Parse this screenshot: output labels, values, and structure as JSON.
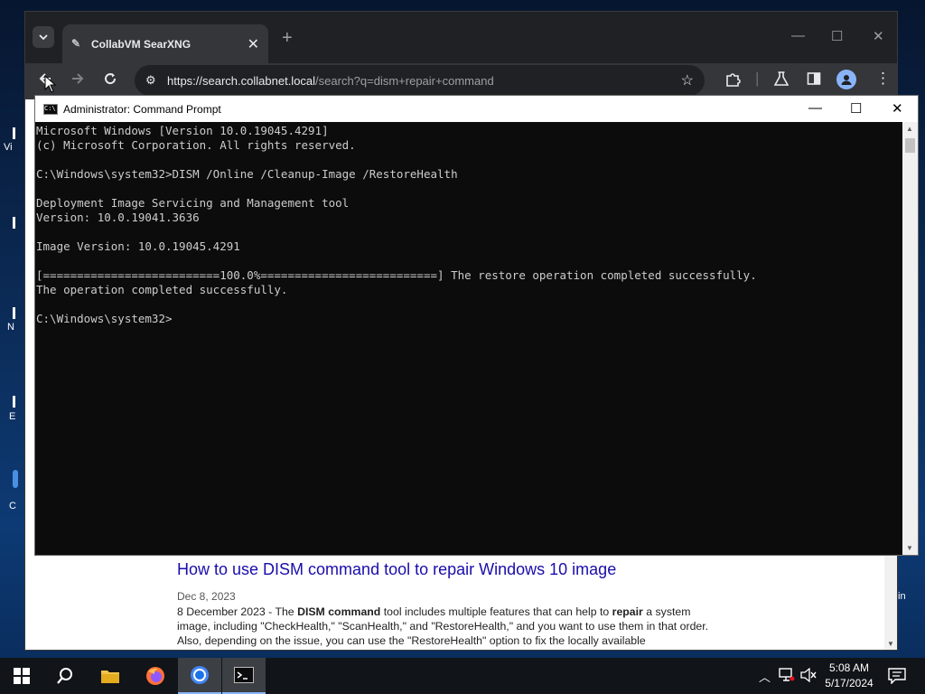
{
  "desktop": {
    "labels": [
      "Vi",
      "N",
      "E",
      "C",
      "in"
    ]
  },
  "browser": {
    "tab_title": "CollabVM SearXNG",
    "new_tab_symbol": "+",
    "url_host": "https://search.collabnet.local",
    "url_rest": "/search?q=dism+repair+command",
    "result": {
      "title": "How to use DISM command tool to repair Windows 10 image",
      "date": "Dec 8, 2023",
      "snippet": {
        "s1": "8 December 2023 - The ",
        "b1": "DISM command",
        "s2": " tool includes multiple features that can help to ",
        "b2": "repair",
        "s3": " a system image, including \"CheckHealth,\" \"ScanHealth,\" and \"RestoreHealth,\" and you want to use them in that order. Also, depending on the issue, you can use the \"RestoreHealth\" option to fix the locally available"
      }
    }
  },
  "cmd": {
    "title": "Administrator: Command Prompt",
    "lines": [
      "Microsoft Windows [Version 10.0.19045.4291]",
      "(c) Microsoft Corporation. All rights reserved.",
      "",
      "C:\\Windows\\system32>DISM /Online /Cleanup-Image /RestoreHealth",
      "",
      "Deployment Image Servicing and Management tool",
      "Version: 10.0.19041.3636",
      "",
      "Image Version: 10.0.19045.4291",
      "",
      "[==========================100.0%==========================] The restore operation completed successfully.",
      "The operation completed successfully.",
      "",
      "C:\\Windows\\system32>"
    ]
  },
  "taskbar": {
    "time": "5:08 AM",
    "date": "5/17/2024",
    "icons": [
      "windows-start-icon",
      "search-icon",
      "file-explorer-icon",
      "firefox-icon",
      "chrome-icon",
      "command-prompt-icon"
    ]
  },
  "colors": {
    "link": "#1a0dab",
    "chrome_dark": "#202124",
    "accent": "#8ab4f8"
  }
}
